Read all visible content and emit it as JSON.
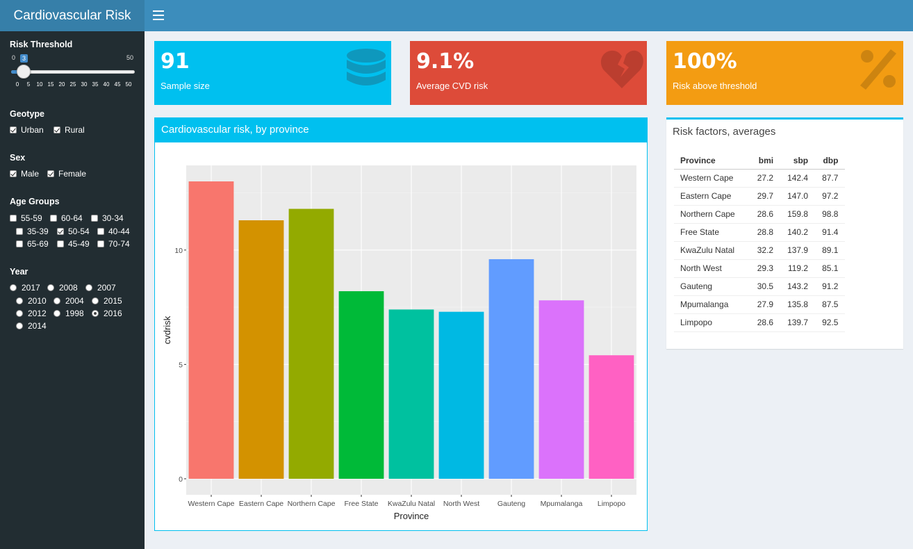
{
  "app": {
    "title": "Cardiovascular Risk"
  },
  "sidebar": {
    "risk_threshold": {
      "label": "Risk Threshold",
      "min": "0",
      "max": "50",
      "value": "3",
      "ticks": [
        "0",
        "5",
        "10",
        "15",
        "20",
        "25",
        "30",
        "35",
        "40",
        "45",
        "50"
      ]
    },
    "geotype": {
      "label": "Geotype",
      "options": [
        {
          "label": "Urban",
          "checked": true
        },
        {
          "label": "Rural",
          "checked": true
        }
      ]
    },
    "sex": {
      "label": "Sex",
      "options": [
        {
          "label": "Male",
          "checked": true
        },
        {
          "label": "Female",
          "checked": true
        }
      ]
    },
    "age_groups": {
      "label": "Age Groups",
      "options": [
        {
          "label": "55-59",
          "checked": false
        },
        {
          "label": "60-64",
          "checked": false
        },
        {
          "label": "30-34",
          "checked": false
        },
        {
          "label": "35-39",
          "checked": false
        },
        {
          "label": "50-54",
          "checked": true
        },
        {
          "label": "40-44",
          "checked": false
        },
        {
          "label": "65-69",
          "checked": false
        },
        {
          "label": "45-49",
          "checked": false
        },
        {
          "label": "70-74",
          "checked": false
        }
      ]
    },
    "year": {
      "label": "Year",
      "options": [
        {
          "label": "2017",
          "selected": false
        },
        {
          "label": "2008",
          "selected": false
        },
        {
          "label": "2007",
          "selected": false
        },
        {
          "label": "2010",
          "selected": false
        },
        {
          "label": "2004",
          "selected": false
        },
        {
          "label": "2015",
          "selected": false
        },
        {
          "label": "2012",
          "selected": false
        },
        {
          "label": "1998",
          "selected": false
        },
        {
          "label": "2016",
          "selected": true
        },
        {
          "label": "2014",
          "selected": false
        }
      ]
    }
  },
  "info_boxes": [
    {
      "value": "91",
      "label": "Sample size",
      "color": "#00c0ef",
      "icon": "database-icon"
    },
    {
      "value": "9.1%",
      "label": "Average CVD risk",
      "color": "#dd4b39",
      "icon": "broken-heart-icon"
    },
    {
      "value": "100%",
      "label": "Risk above threshold",
      "color": "#f39c12",
      "icon": "percent-icon"
    }
  ],
  "chart_box": {
    "title": "Cardiovascular risk, by province"
  },
  "chart_data": {
    "type": "bar",
    "categories": [
      "Western Cape",
      "Eastern Cape",
      "Northern Cape",
      "Free State",
      "KwaZulu Natal",
      "North West",
      "Gauteng",
      "Mpumalanga",
      "Limpopo"
    ],
    "values": [
      13.0,
      11.3,
      11.8,
      8.2,
      7.4,
      7.3,
      9.6,
      7.8,
      5.4
    ],
    "colors": [
      "#F8766D",
      "#D39200",
      "#93AA00",
      "#00BA38",
      "#00C19F",
      "#00B9E3",
      "#619CFF",
      "#DB72FB",
      "#FF61C3"
    ],
    "xlabel": "Province",
    "ylabel": "cvdrisk",
    "ylim": [
      -0.7,
      13.7
    ],
    "yticks": [
      0,
      5,
      10
    ],
    "grid": true
  },
  "risk_table": {
    "title": "Risk factors, averages",
    "columns": [
      "Province",
      "bmi",
      "sbp",
      "dbp"
    ],
    "rows": [
      [
        "Western Cape",
        "27.2",
        "142.4",
        "87.7"
      ],
      [
        "Eastern Cape",
        "29.7",
        "147.0",
        "97.2"
      ],
      [
        "Northern Cape",
        "28.6",
        "159.8",
        "98.8"
      ],
      [
        "Free State",
        "28.8",
        "140.2",
        "91.4"
      ],
      [
        "KwaZulu Natal",
        "32.2",
        "137.9",
        "89.1"
      ],
      [
        "North West",
        "29.3",
        "119.2",
        "85.1"
      ],
      [
        "Gauteng",
        "30.5",
        "143.2",
        "91.2"
      ],
      [
        "Mpumalanga",
        "27.9",
        "135.8",
        "87.5"
      ],
      [
        "Limpopo",
        "28.6",
        "139.7",
        "92.5"
      ]
    ]
  }
}
